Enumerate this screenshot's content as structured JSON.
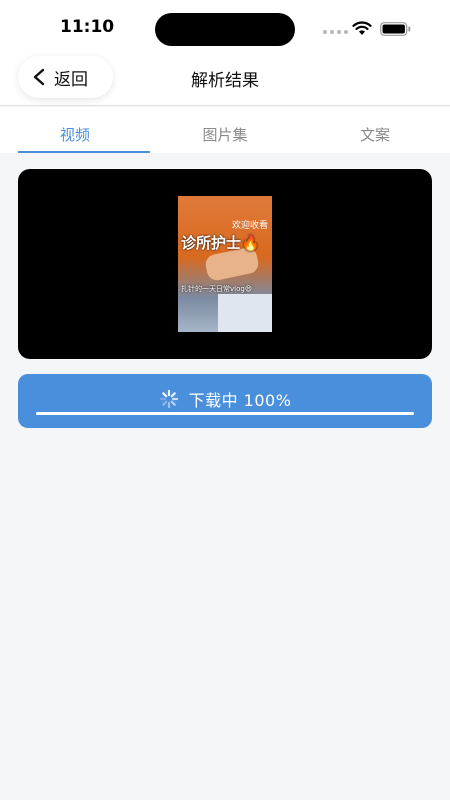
{
  "status_bar": {
    "time": "11:10"
  },
  "nav": {
    "back_label": "返回",
    "title": "解析结果"
  },
  "tabs": [
    {
      "label": "视频",
      "active": true
    },
    {
      "label": "图片集",
      "active": false
    },
    {
      "label": "文案",
      "active": false
    }
  ],
  "video": {
    "thumbnail_text": {
      "top": "欢迎收看",
      "title": "诊所护士🔥",
      "subtitle": "扎针的一天日常vlog😄"
    }
  },
  "download": {
    "label": "下载中 100%",
    "progress": 1.0
  },
  "colors": {
    "accent": "#4a8fdc",
    "background": "#f4f6f8"
  }
}
